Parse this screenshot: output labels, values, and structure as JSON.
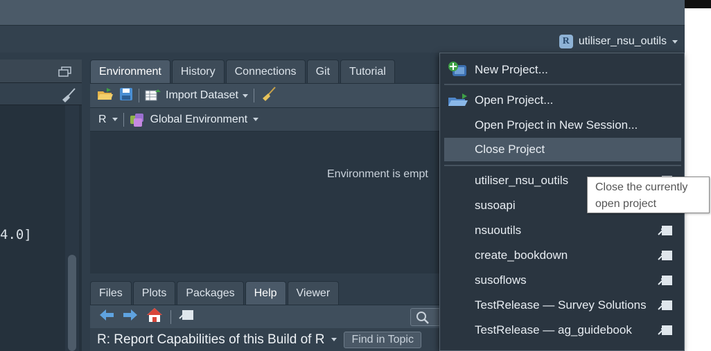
{
  "header": {
    "project_name": "utiliser_nsu_outils"
  },
  "console": {
    "visible_text": "4.0]"
  },
  "environment_pane": {
    "tabs": [
      "Environment",
      "History",
      "Connections",
      "Git",
      "Tutorial"
    ],
    "active_tab": "Environment",
    "import_dataset_label": "Import Dataset",
    "language_selector": "R",
    "scope_selector": "Global Environment",
    "empty_message": "Environment is empt"
  },
  "files_pane": {
    "tabs": [
      "Files",
      "Plots",
      "Packages",
      "Help",
      "Viewer"
    ],
    "active_tab": "Help",
    "help_title": "R: Report Capabilities of this Build of R",
    "find_in_topic_label": "Find in Topic"
  },
  "project_menu": {
    "new_project": "New Project...",
    "open_project": "Open Project...",
    "open_project_new_session": "Open Project in New Session...",
    "close_project": "Close Project",
    "recent_projects": [
      "utiliser_nsu_outils",
      "susoapi",
      "nsuoutils",
      "create_bookdown",
      "susoflows",
      "TestRelease — Survey Solutions",
      "TestRelease — ag_guidebook"
    ]
  },
  "tooltip": {
    "line1": "Close the currently",
    "line2": "open project"
  },
  "colors": {
    "background": "#2f3d4a",
    "menu_background": "#2a3540",
    "hover_item": "#4a5866",
    "text": "#e8edf2"
  }
}
